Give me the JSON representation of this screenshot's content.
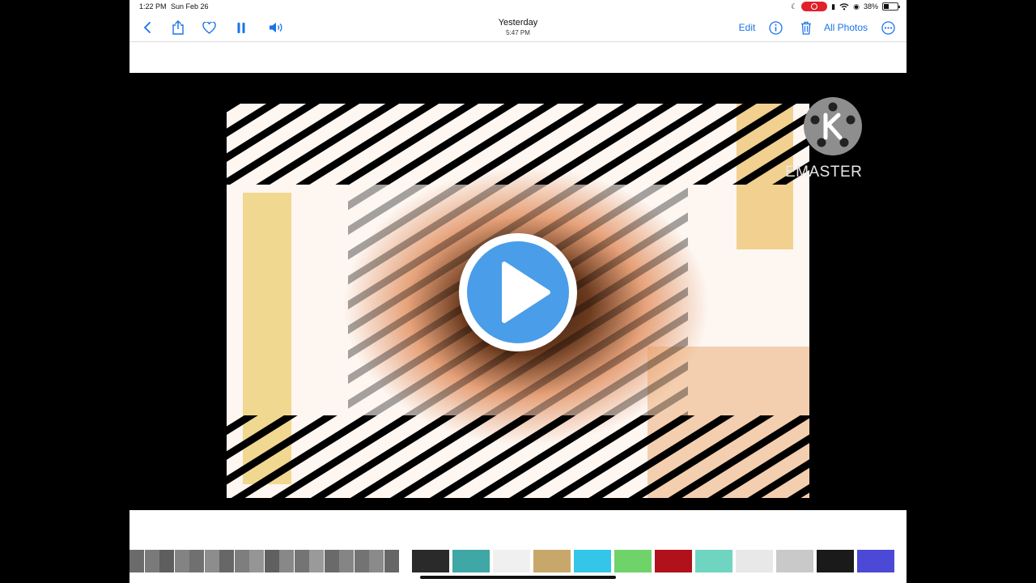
{
  "status_bar": {
    "time": "1:22 PM",
    "date": "Sun Feb 26",
    "battery_percent": "38%",
    "recording_indicator": "red-record-pill",
    "battery_level": 0.38
  },
  "nav": {
    "title": "Yesterday",
    "subtitle": "5:47 PM",
    "edit_label": "Edit",
    "all_photos_label": "All Photos",
    "icons": {
      "back": "chevron-left-icon",
      "share": "share-icon",
      "favorite": "heart-icon",
      "pause": "pause-icon",
      "volume": "speaker-icon",
      "info": "info-icon",
      "delete": "trash-icon",
      "more": "ellipsis-circle-icon"
    },
    "accent_color": "#1a73e8"
  },
  "video": {
    "watermark_text": "EMASTER",
    "watermark_logo": "kinemaster-k-logo",
    "play_button_color": "#4a9de8",
    "state": "paused"
  },
  "thumbnails": {
    "colors": [
      "#6b6b6b",
      "#7a7a7a",
      "#5e5e5e",
      "#838383",
      "#707070",
      "#8d8d8d",
      "#676767",
      "#7e7e7e",
      "#959595",
      "#606060",
      "#888888",
      "#747474",
      "#9a9a9a",
      "#6a6a6a",
      "#858585",
      "#737373",
      "#8a8a8a",
      "#666666",
      "#2a2a2a",
      "#3fa7a5",
      "#f0f0f0",
      "#c8a76a",
      "#33c6e8",
      "#6fd36a",
      "#b0111a",
      "#6fd5c0",
      "#e8e8e8",
      "#c9c9c9",
      "#1a1a1a",
      "#4c49d6",
      "#1d1ad8"
    ]
  }
}
